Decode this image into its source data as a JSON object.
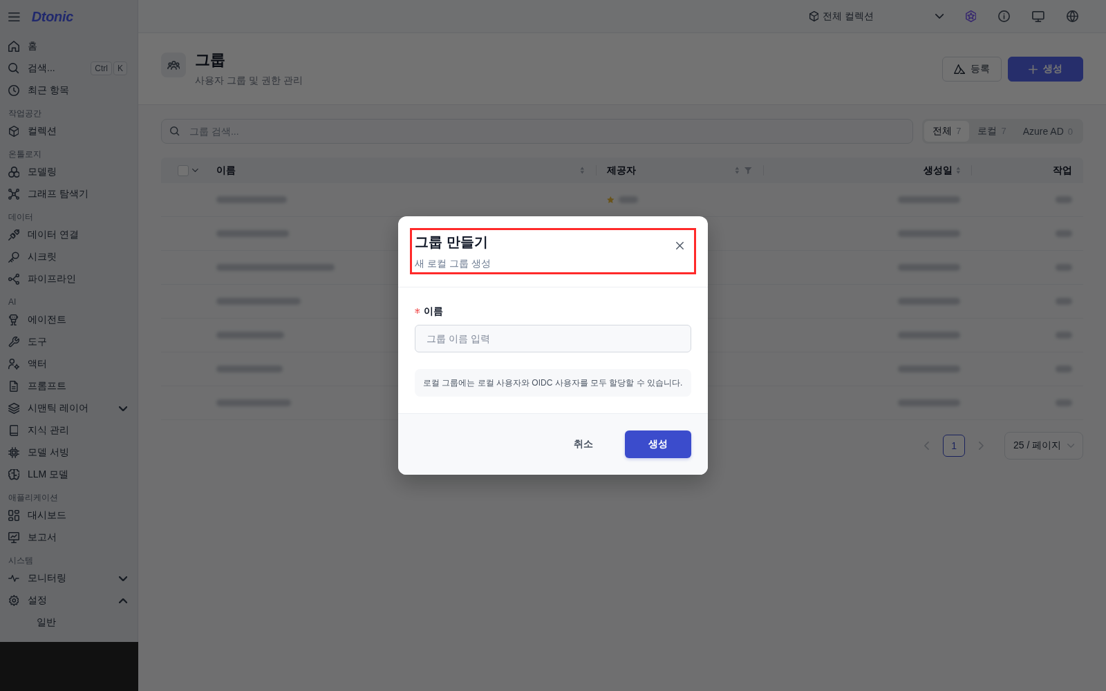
{
  "sidebar": {
    "logo": "Dtonic",
    "sections": [
      {
        "items": [
          {
            "label": "홈"
          },
          {
            "label": "검색...",
            "shortcut": [
              "Ctrl",
              "K"
            ]
          },
          {
            "label": "최근 항목"
          }
        ]
      },
      {
        "title": "작업공간",
        "items": [
          {
            "label": "컬렉션"
          }
        ]
      },
      {
        "title": "온톨로지",
        "items": [
          {
            "label": "모델링"
          },
          {
            "label": "그래프 탐색기"
          }
        ]
      },
      {
        "title": "데이터",
        "items": [
          {
            "label": "데이터 연결"
          },
          {
            "label": "시크릿"
          },
          {
            "label": "파이프라인"
          }
        ]
      },
      {
        "title": "AI",
        "items": [
          {
            "label": "에이전트"
          },
          {
            "label": "도구"
          },
          {
            "label": "액터"
          },
          {
            "label": "프롬프트"
          },
          {
            "label": "시맨틱 레이어",
            "expanded": false
          },
          {
            "label": "지식 관리"
          },
          {
            "label": "모델 서빙"
          },
          {
            "label": "LLM 모델"
          }
        ]
      },
      {
        "title": "애플리케이션",
        "items": [
          {
            "label": "대시보드"
          },
          {
            "label": "보고서"
          }
        ]
      },
      {
        "title": "시스템",
        "items": [
          {
            "label": "모니터링",
            "expanded": false
          },
          {
            "label": "설정",
            "expanded": true,
            "children": [
              {
                "label": "일반"
              }
            ]
          }
        ]
      }
    ]
  },
  "topbar": {
    "collection": "전체 컬렉션"
  },
  "page_header": {
    "title": "그룹",
    "subtitle": "사용자 그룹 및 권한 관리",
    "buttons": [
      {
        "label": "등록",
        "kind": "outline"
      },
      {
        "label": "생성",
        "kind": "primary"
      }
    ]
  },
  "search": {
    "placeholder": "그룹 검색..."
  },
  "filters": [
    {
      "label": "전체",
      "count": "7",
      "selected": true
    },
    {
      "label": "로컬",
      "count": "7",
      "selected": false
    },
    {
      "label": "Azure AD",
      "count": "0",
      "selected": false
    }
  ],
  "table": {
    "select_all": {
      "checked": false
    },
    "columns": [
      {
        "label": "이름",
        "sortable": true,
        "filterable": false
      },
      {
        "label": "제공자",
        "sortable": true,
        "filterable": true
      },
      {
        "label": "생성일",
        "sortable": true,
        "filterable": false
      },
      {
        "label": "작업",
        "sortable": false,
        "filterable": false
      }
    ],
    "rows": [
      {
        "kind": "blurred_with_provider"
      },
      {
        "kind": "blurred"
      },
      {
        "kind": "blurred"
      },
      {
        "kind": "blurred"
      },
      {
        "kind": "blurred"
      },
      {
        "kind": "blurred"
      },
      {
        "kind": "blurred"
      }
    ]
  },
  "pagination": {
    "prev_disabled": true,
    "next_disabled": true,
    "pages": [
      {
        "label": "1",
        "selected": true
      }
    ],
    "page_size": "25 / 페이지"
  },
  "modal": {
    "title": "그룹 만들기",
    "subtitle": "새 로컬 그룹 생성",
    "highlighted": true,
    "field": {
      "label": "이름",
      "required": true,
      "placeholder": "그룹 이름 입력"
    },
    "note": "로컬 그룹에는 로컬 사용자와 OIDC 사용자를 모두 할당할 수 있습니다.",
    "buttons": [
      {
        "label": "취소",
        "kind": "ghost"
      },
      {
        "label": "생성",
        "kind": "primary"
      }
    ]
  }
}
